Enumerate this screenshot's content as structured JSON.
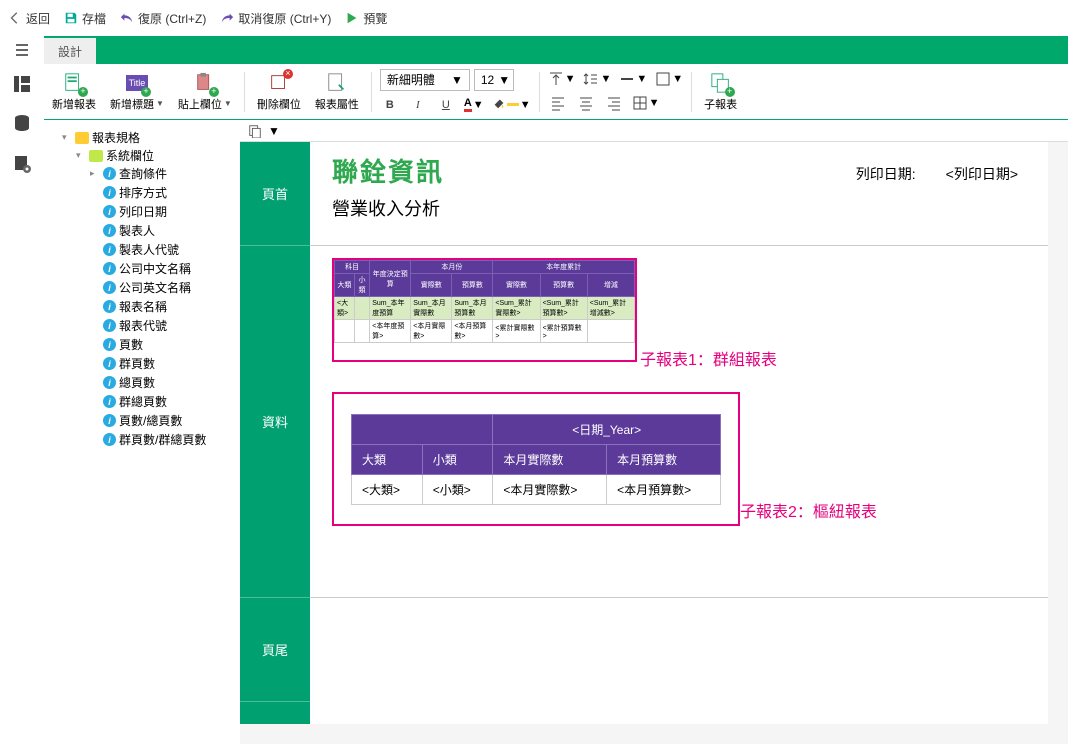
{
  "topbar": {
    "back": "返回",
    "save": "存檔",
    "undo": "復原 (Ctrl+Z)",
    "redo": "取消復原 (Ctrl+Y)",
    "preview": "預覽"
  },
  "tab": {
    "design": "設計"
  },
  "ribbon": {
    "new_report": "新增報表",
    "new_title": "新增標題",
    "paste_field": "貼上欄位",
    "delete_field": "刪除欄位",
    "report_prop": "報表屬性",
    "font_name": "新細明體",
    "font_size": "12",
    "sub_report": "子報表"
  },
  "tree": {
    "root": "報表規格",
    "sys": "系統欄位",
    "items": [
      "查詢條件",
      "排序方式",
      "列印日期",
      "製表人",
      "製表人代號",
      "公司中文名稱",
      "公司英文名稱",
      "報表名稱",
      "報表代號",
      "頁數",
      "群頁數",
      "總頁數",
      "群總頁數",
      "頁數/總頁數",
      "群頁數/群總頁數"
    ]
  },
  "sections": {
    "header": "頁首",
    "data": "資料",
    "footer": "頁尾"
  },
  "header": {
    "company": "聯銓資訊",
    "subtitle": "營業收入分析",
    "print_label": "列印日期:",
    "print_value": "<列印日期>"
  },
  "sub_labels": {
    "s1": "子報表1：群組報表",
    "s2": "子報表2：樞紐報表"
  },
  "mini_table": {
    "h": [
      "科目",
      "年度決定預算",
      "本月份",
      "本年度累計"
    ],
    "sub_left": [
      "大類",
      "小類"
    ],
    "sub_mid": [
      "實際數",
      "預算數"
    ],
    "sub_right": [
      "實際數",
      "預算數",
      "增減"
    ],
    "row_totals": [
      "<大類>",
      "Sum_本年度預算",
      "Sum_本月實際數",
      "Sum_本月預算數",
      "<Sum_累計實際數>",
      "<Sum_累計預算數>",
      "<Sum_累計增減數>"
    ],
    "row_white": [
      "<本年度預算>",
      "<本月實際數>",
      "<本月預算數>",
      "<累計實際數>",
      "<累計預算數>"
    ]
  },
  "pivot": {
    "span": "<日期_Year>",
    "headers": [
      "大類",
      "小類",
      "本月實際數",
      "本月預算數"
    ],
    "cells": [
      "<大類>",
      "<小類>",
      "<本月實際數>",
      "<本月預算數>"
    ]
  }
}
